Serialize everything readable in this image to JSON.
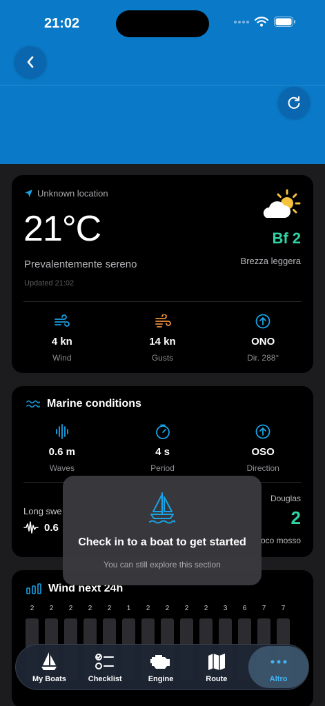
{
  "status_bar": {
    "time": "21:02"
  },
  "weather": {
    "location": "Unknown location",
    "temperature": "21°C",
    "condition": "Prevalentemente sereno",
    "updated": "Updated 21:02",
    "beaufort": "Bf 2",
    "breeze": "Brezza leggera",
    "wind": {
      "value": "4 kn",
      "label": "Wind"
    },
    "gusts": {
      "value": "14 kn",
      "label": "Gusts"
    },
    "direction": {
      "value": "ONO",
      "label": "Dir. 288°"
    }
  },
  "marine": {
    "title": "Marine conditions",
    "waves": {
      "value": "0.6 m",
      "label": "Waves"
    },
    "period": {
      "value": "4 s",
      "label": "Period"
    },
    "direction": {
      "value": "OSO",
      "label": "Direction"
    },
    "long_swell_label": "Long swe",
    "long_swell_value": "0.6",
    "douglas_label": "Douglas",
    "douglas_value": "2",
    "douglas_desc": "oco mosso"
  },
  "wind_forecast": {
    "title": "Wind next 24h",
    "values": [
      "2",
      "2",
      "2",
      "2",
      "2",
      "1",
      "2",
      "2",
      "2",
      "2",
      "3",
      "6",
      "7",
      "7"
    ]
  },
  "overlay": {
    "title": "Check in to a boat to get started",
    "subtitle": "You can still explore this section"
  },
  "tabs": [
    {
      "label": "My Boats",
      "icon": "sailboat-icon"
    },
    {
      "label": "Checklist",
      "icon": "checklist-icon"
    },
    {
      "label": "Engine",
      "icon": "engine-icon"
    },
    {
      "label": "Route",
      "icon": "map-icon"
    },
    {
      "label": "Altro",
      "icon": "more-dots-icon",
      "active": true
    }
  ],
  "colors": {
    "header": "#0a7ac8",
    "accent": "#2fd3a5",
    "icon_blue": "#1aa3e6",
    "icon_orange": "#f0913a",
    "active_tab": "#41b4f5"
  }
}
